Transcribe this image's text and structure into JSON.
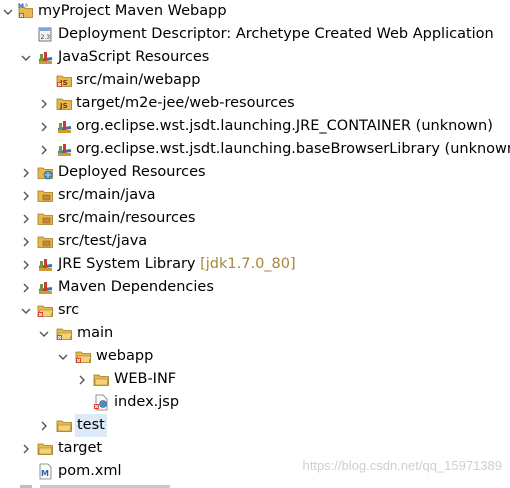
{
  "tree": {
    "project": "myProject Maven Webapp",
    "deployment_descriptor": "Deployment Descriptor: Archetype Created Web Application",
    "javascript_resources": "JavaScript Resources",
    "js_src_main_webapp": "src/main/webapp",
    "js_target_web_resources": "target/m2e-jee/web-resources",
    "js_jre_container": "org.eclipse.wst.jsdt.launching.JRE_CONTAINER (unknown)",
    "js_base_browser_library": "org.eclipse.wst.jsdt.launching.baseBrowserLibrary (unknown)",
    "deployed_resources": "Deployed Resources",
    "src_main_java": "src/main/java",
    "src_main_resources": "src/main/resources",
    "src_test_java": "src/test/java",
    "jre_system_library": "JRE System Library",
    "jre_version": "[jdk1.7.0_80]",
    "maven_dependencies": "Maven Dependencies",
    "src": "src",
    "main": "main",
    "webapp": "webapp",
    "web_inf": "WEB-INF",
    "index_jsp": "index.jsp",
    "test": "test",
    "target": "target",
    "pom_xml": "pom.xml"
  },
  "watermark": "https://blog.csdn.net/qq_15971389",
  "colors": {
    "selection": "#dce9f7",
    "decoration": "#a5873a",
    "folder": "#e8b94a",
    "error_badge": "#d63a2a",
    "maven_badge": "#2a64b4"
  }
}
